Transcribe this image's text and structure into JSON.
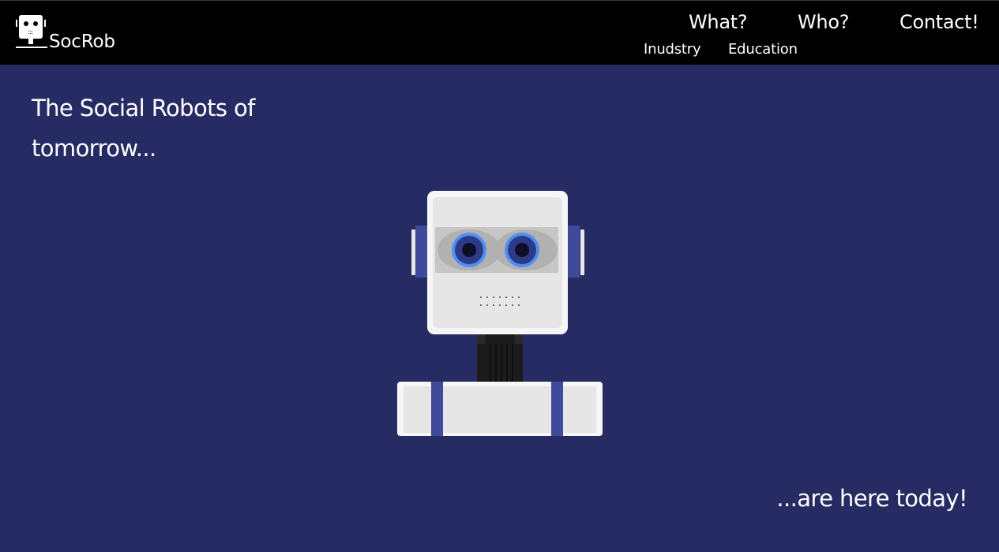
{
  "brand": {
    "name": "SocRob",
    "logo_icon": "robot-head-icon"
  },
  "nav": {
    "what": "What?",
    "who": "Who?",
    "contact": "Contact!",
    "industry": "Inudstry",
    "education": "Education"
  },
  "hero": {
    "title": "The Social Robots of tomorrow...",
    "tagline": "...are here today!"
  },
  "colors": {
    "background": "#262b64",
    "header": "#000000",
    "robot_accent": "#3f4a9a",
    "eye_glow": "#4f8ff5",
    "robot_body": "#e6e6e6"
  },
  "illustration": "robot-illustration"
}
